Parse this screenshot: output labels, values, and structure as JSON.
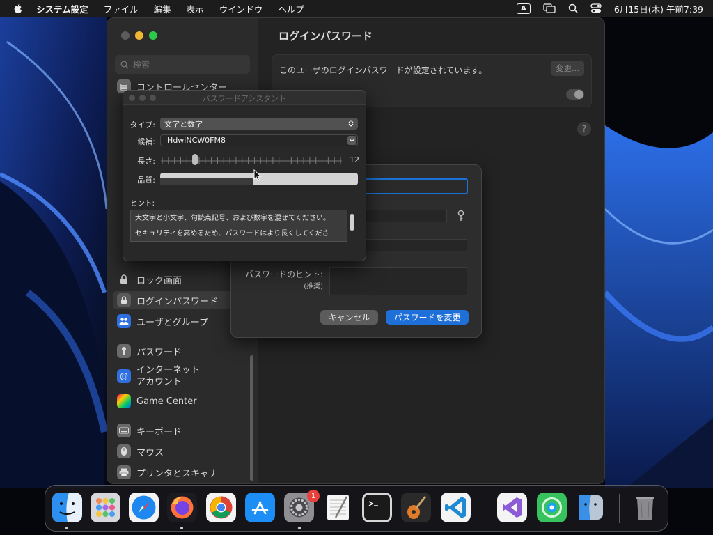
{
  "menubar": {
    "app_name": "システム設定",
    "items": [
      "ファイル",
      "編集",
      "表示",
      "ウインドウ",
      "ヘルプ"
    ],
    "input_mode": "A",
    "clock": "6月15日(木) 午前7:39"
  },
  "settings": {
    "search_placeholder": "検索",
    "sidebar": {
      "control_center": "コントロールセンター",
      "lock_screen": "ロック画面",
      "login_password": "ログインパスワード",
      "users_groups": "ユーザとグループ",
      "passwords": "パスワード",
      "internet_accounts_1": "インターネット",
      "internet_accounts_2": "アカウント",
      "game_center": "Game Center",
      "keyboard": "キーボード",
      "mouse": "マウス",
      "printers": "プリンタとスキャナ"
    },
    "main": {
      "title": "ログインパスワード",
      "description": "このユーザのログインパスワードが設定されています。",
      "change_button": "変更...",
      "help": "?"
    }
  },
  "change_sheet": {
    "hint_label": "パスワードのヒント:",
    "hint_sub": "(推奨)",
    "cancel": "キャンセル",
    "confirm": "パスワードを変更"
  },
  "assistant": {
    "title": "パスワードアシスタント",
    "type_label": "タイプ:",
    "type_value": "文字と数字",
    "suggestion_label": "候補:",
    "suggestion_value": "lHdwiNCW0FM8",
    "length_label": "長さ:",
    "length_value": "12",
    "length_fraction": 0.19,
    "quality_label": "品質:",
    "quality_fraction": 0.47,
    "hint_title": "ヒント:",
    "hint_lines": [
      "大文字と小文字、句読点記号、および数字を混ぜてください。",
      "セキュリティを高めるため、パスワードはより長くしてくださ"
    ]
  },
  "dock": {
    "settings_badge": "1"
  },
  "colors": {
    "accent": "#1f6fd8",
    "traffic_yellow": "#f0b832",
    "traffic_green": "#2ec84a",
    "badge": "#e8403a"
  }
}
